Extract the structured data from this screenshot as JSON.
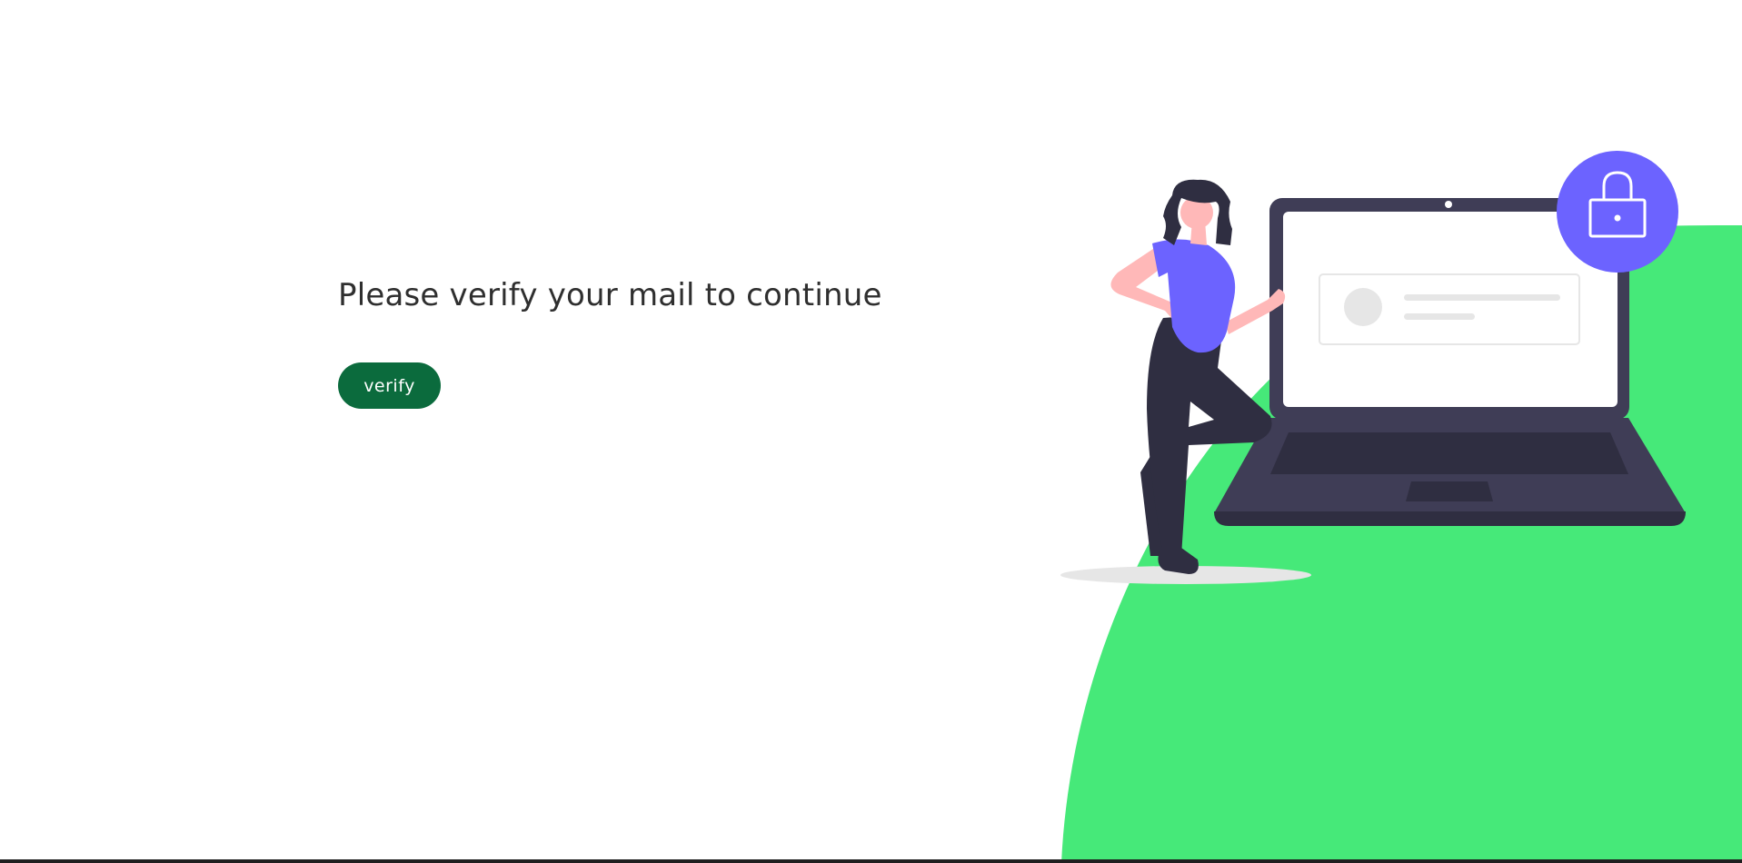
{
  "main": {
    "heading": "Please verify your mail to continue",
    "verify_label": "verify"
  },
  "colors": {
    "accent_green": "#46e979",
    "button_green": "#0b6b3d",
    "lock_purple": "#6c63ff",
    "laptop_dark": "#3f3d56"
  },
  "icons": {
    "lock": "lock-icon"
  }
}
